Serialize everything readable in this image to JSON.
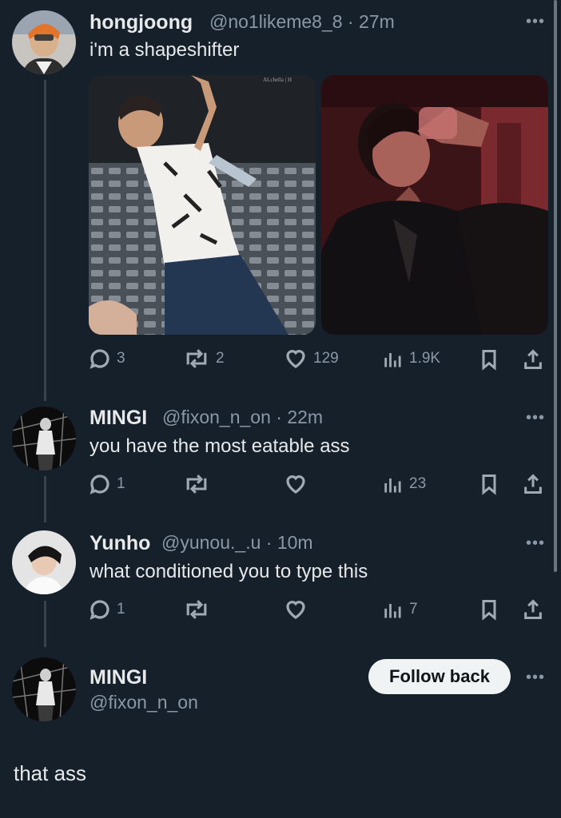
{
  "post": {
    "name": "hongjoong",
    "handle": "@no1likeme8_8",
    "time": "· 27m",
    "text": "i'm a shapeshifter",
    "photo_watermark": "ALchella | H",
    "stats": {
      "replies": "3",
      "reposts": "2",
      "likes": "129",
      "views": "1.9K"
    }
  },
  "reply1": {
    "name": "MINGI",
    "handle": "@fixon_n_on",
    "time": "· 22m",
    "text": "you have the most eatable ass",
    "stats": {
      "replies": "1",
      "views": "23"
    }
  },
  "reply2": {
    "name": "Yunho",
    "handle": "@yunou._.u",
    "time": "· 10m",
    "text": "what conditioned you to type this",
    "stats": {
      "replies": "1",
      "views": "7"
    }
  },
  "composer": {
    "name": "MINGI",
    "handle": "@fixon_n_on",
    "follow_label": "Follow back",
    "text": "that ass"
  },
  "ui": {
    "more": "•••"
  },
  "colors": {
    "background": "#15202b",
    "text": "#e7e9ea",
    "muted": "#8b98a5",
    "button_bg": "#eff3f4"
  }
}
